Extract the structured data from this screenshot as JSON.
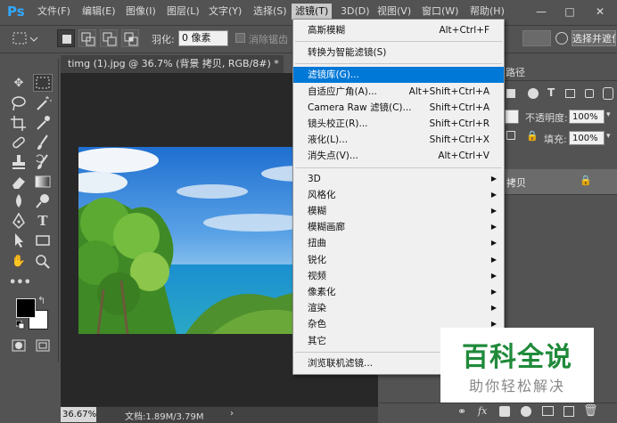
{
  "app": {
    "logo": "Ps"
  },
  "menubar": {
    "items": [
      "文件(F)",
      "编辑(E)",
      "图像(I)",
      "图层(L)",
      "文字(Y)",
      "选择(S)",
      "滤镜(T)",
      "3D(D)",
      "视图(V)",
      "窗口(W)",
      "帮助(H)"
    ],
    "active_index": 6
  },
  "window_controls": {
    "minimize": "—",
    "maximize": "□",
    "close": "✕"
  },
  "options": {
    "feather_label": "羽化:",
    "feather_value": "0 像素",
    "smooth_label": "消除锯齿",
    "select_mask_label": "选择并遮住"
  },
  "document": {
    "tab_title": "timg (1).jpg @ 36.7% (背景 拷贝, RGB/8#) *",
    "zoom": "36.67%",
    "doc_info": "文档:1.89M/3.79M"
  },
  "right_panel": {
    "panel_tab": "路径",
    "opacity_label": "不透明度:",
    "opacity_value": "100%",
    "fill_label": "填充:",
    "fill_value": "100%",
    "layer_name": "拷贝",
    "fx_label": "fx"
  },
  "filter_menu": {
    "items": [
      {
        "label": "高斯模糊",
        "shortcut": "Alt+Ctrl+F",
        "submenu": false
      },
      {
        "sep": true
      },
      {
        "label": "转换为智能滤镜(S)",
        "shortcut": "",
        "submenu": false
      },
      {
        "sep": true
      },
      {
        "label": "滤镜库(G)...",
        "shortcut": "",
        "submenu": false,
        "highlight": true
      },
      {
        "label": "自适应广角(A)...",
        "shortcut": "Alt+Shift+Ctrl+A",
        "submenu": false
      },
      {
        "label": "Camera Raw 滤镜(C)...",
        "shortcut": "Shift+Ctrl+A",
        "submenu": false
      },
      {
        "label": "镜头校正(R)...",
        "shortcut": "Shift+Ctrl+R",
        "submenu": false
      },
      {
        "label": "液化(L)...",
        "shortcut": "Shift+Ctrl+X",
        "submenu": false
      },
      {
        "label": "消失点(V)...",
        "shortcut": "Alt+Ctrl+V",
        "submenu": false
      },
      {
        "sep": true
      },
      {
        "label": "3D",
        "shortcut": "",
        "submenu": true
      },
      {
        "label": "风格化",
        "shortcut": "",
        "submenu": true
      },
      {
        "label": "模糊",
        "shortcut": "",
        "submenu": true
      },
      {
        "label": "模糊画廊",
        "shortcut": "",
        "submenu": true
      },
      {
        "label": "扭曲",
        "shortcut": "",
        "submenu": true
      },
      {
        "label": "锐化",
        "shortcut": "",
        "submenu": true
      },
      {
        "label": "视频",
        "shortcut": "",
        "submenu": true
      },
      {
        "label": "像素化",
        "shortcut": "",
        "submenu": true
      },
      {
        "label": "渲染",
        "shortcut": "",
        "submenu": true
      },
      {
        "label": "杂色",
        "shortcut": "",
        "submenu": true
      },
      {
        "label": "其它",
        "shortcut": "",
        "submenu": true
      },
      {
        "sep": true
      },
      {
        "label": "浏览联机滤镜...",
        "shortcut": "",
        "submenu": false
      }
    ]
  },
  "watermark": {
    "title": "百科全说",
    "subtitle": "助你轻松解决"
  },
  "colors": {
    "menu_highlight": "#0078d7",
    "ui_bg": "#535353",
    "watermark_green": "#1f8a3a"
  }
}
